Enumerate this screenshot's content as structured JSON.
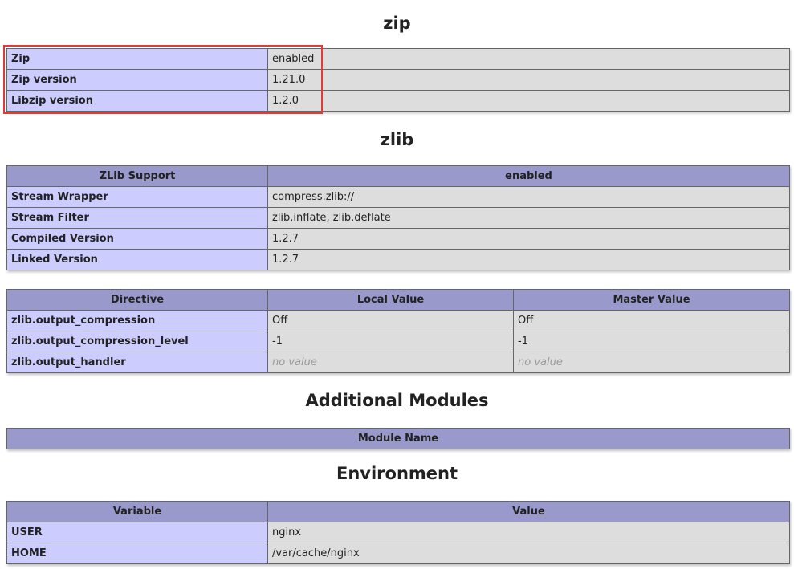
{
  "sections": {
    "zip": {
      "title": "zip",
      "rows": [
        {
          "name": "Zip",
          "value": "enabled"
        },
        {
          "name": "Zip version",
          "value": "1.21.0"
        },
        {
          "name": "Libzip version",
          "value": "1.2.0"
        }
      ]
    },
    "zlib": {
      "title": "zlib",
      "support": {
        "name": "ZLib Support",
        "value": "enabled"
      },
      "rows": [
        {
          "name": "Stream Wrapper",
          "value": "compress.zlib://"
        },
        {
          "name": "Stream Filter",
          "value": "zlib.inflate, zlib.deflate"
        },
        {
          "name": "Compiled Version",
          "value": "1.2.7"
        },
        {
          "name": "Linked Version",
          "value": "1.2.7"
        }
      ],
      "directives": {
        "headers": [
          "Directive",
          "Local Value",
          "Master Value"
        ],
        "rows": [
          {
            "name": "zlib.output_compression",
            "local": "Off",
            "master": "Off"
          },
          {
            "name": "zlib.output_compression_level",
            "local": "-1",
            "master": "-1"
          },
          {
            "name": "zlib.output_handler",
            "local": "no value",
            "master": "no value"
          }
        ]
      }
    },
    "additional_modules": {
      "title": "Additional Modules",
      "header": "Module Name"
    },
    "environment": {
      "title": "Environment",
      "headers": [
        "Variable",
        "Value"
      ],
      "rows": [
        {
          "name": "USER",
          "value": "nginx"
        },
        {
          "name": "HOME",
          "value": "/var/cache/nginx"
        }
      ]
    }
  },
  "colors": {
    "header_bg": "#9999cc",
    "key_bg": "#ccccff",
    "value_bg": "#dddddd",
    "highlight": "#e53935"
  }
}
